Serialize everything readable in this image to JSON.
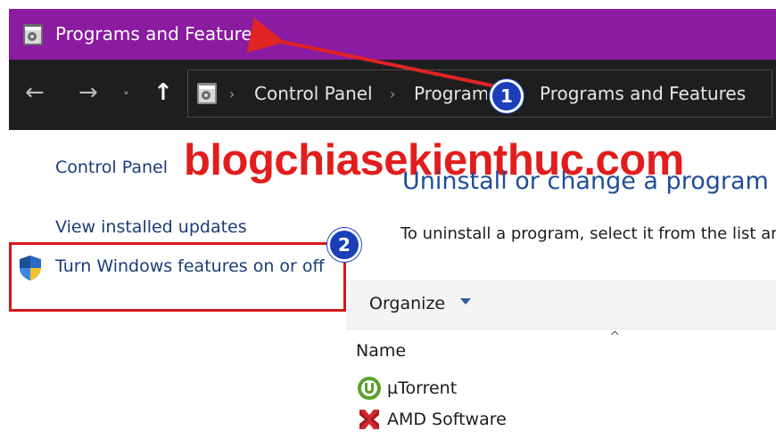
{
  "window": {
    "title": "Programs and Features"
  },
  "navigation": {
    "back_glyph": "←",
    "forward_glyph": "→",
    "recent_glyph": "˅",
    "up_glyph": "↑",
    "breadcrumb": [
      "Control Panel",
      "Programs",
      "Programs and Features"
    ],
    "separator": "›"
  },
  "sidebar": {
    "control_panel_home": "Control Panel",
    "view_updates": "View installed updates",
    "windows_features": "Turn Windows features on or off"
  },
  "watermark": "blogchiasekienthuc.com",
  "main": {
    "heading": "Uninstall or change a program",
    "description": "To uninstall a program, select it from the list and then click Uninstall, Change, or Repair.",
    "organize_label": "Organize",
    "sort_glyph": "^",
    "column_name": "Name",
    "programs": [
      {
        "name": "µTorrent",
        "icon": "utorrent-icon"
      },
      {
        "name": "AMD Software",
        "icon": "amd-software-icon"
      }
    ]
  },
  "annotations": {
    "badge_1": "1",
    "badge_2": "2"
  },
  "colors": {
    "titlebar": "#8b1ba0",
    "addressbar": "#1e1e1e",
    "link": "#1a3c7a",
    "watermark": "#e21d1d",
    "badge": "#1a3fb8",
    "highlight_box": "#d41919"
  }
}
